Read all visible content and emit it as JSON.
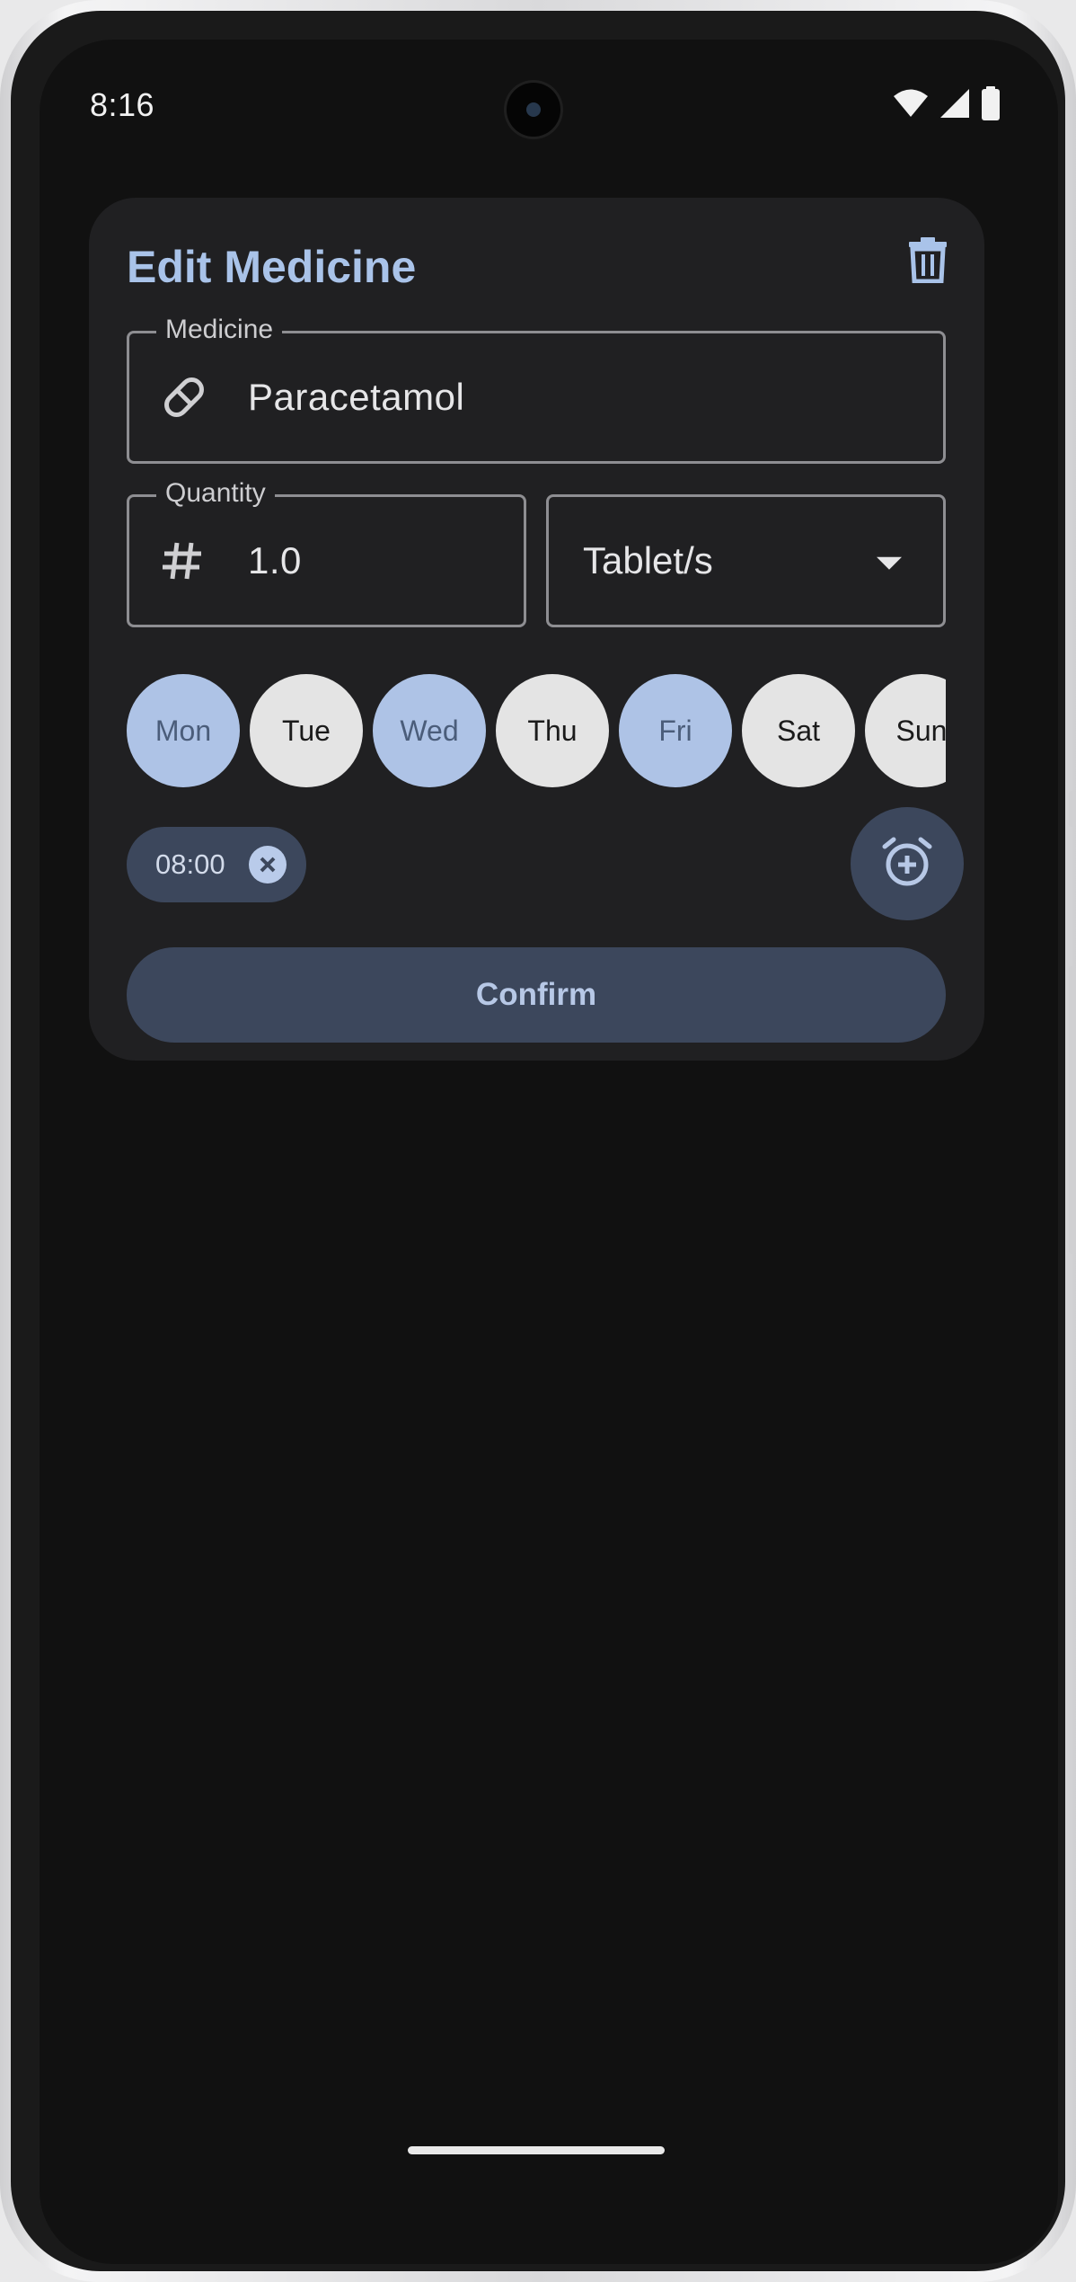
{
  "status_bar": {
    "time": "8:16",
    "icons": [
      "wifi-icon",
      "signal-icon",
      "battery-icon"
    ]
  },
  "dialog": {
    "title": "Edit Medicine",
    "delete_icon": "trash-icon",
    "medicine": {
      "label": "Medicine",
      "value": "Paracetamol",
      "icon": "pill-icon"
    },
    "quantity": {
      "label": "Quantity",
      "value": "1.0",
      "icon": "hash-icon"
    },
    "unit": {
      "selected": "Tablet/s"
    },
    "days": [
      {
        "label": "Mon",
        "selected": true
      },
      {
        "label": "Tue",
        "selected": false
      },
      {
        "label": "Wed",
        "selected": true
      },
      {
        "label": "Thu",
        "selected": false
      },
      {
        "label": "Fri",
        "selected": true
      },
      {
        "label": "Sat",
        "selected": false
      },
      {
        "label": "Sun",
        "selected": false
      }
    ],
    "times": [
      {
        "label": "08:00"
      }
    ],
    "add_alarm_icon": "alarm-add-icon",
    "confirm_label": "Confirm"
  },
  "colors": {
    "accent": "#a9c3e9",
    "tonal_button": "#3c475c",
    "day_selected": "#aec3e6",
    "day_unselected": "#e4e4e4",
    "surface": "#202022",
    "background": "#111111"
  }
}
